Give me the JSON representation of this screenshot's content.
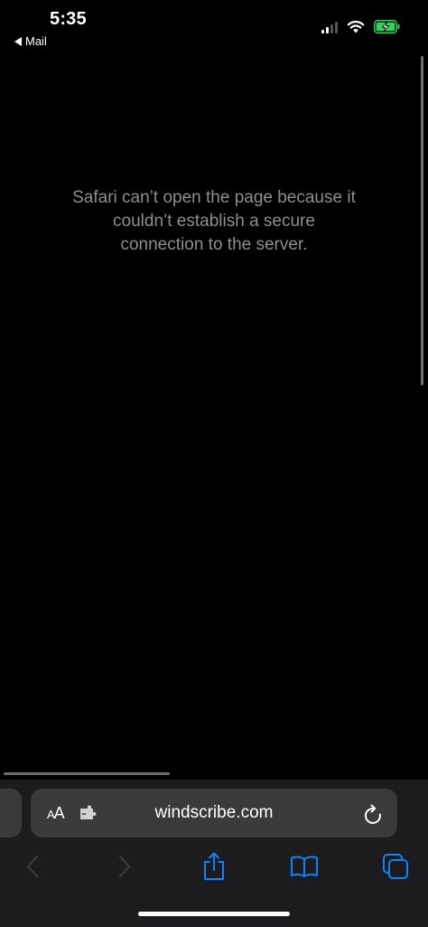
{
  "status_bar": {
    "time": "5:35",
    "back_app": "Mail",
    "signal_bars_filled": 2,
    "signal_bars_total": 4,
    "battery_charging": true,
    "battery_color": "#30d158"
  },
  "page": {
    "message_lines": [
      "Safari can’t open the page because it",
      "couldn’t establish a secure",
      "connection to the server."
    ]
  },
  "address_bar": {
    "reader_label_large": "A",
    "reader_label_small": "A",
    "url": "windscribe.com"
  },
  "toolbar": {
    "back_enabled": false,
    "forward_enabled": false,
    "accent_color": "#0a84ff",
    "disabled_color": "#3a3a3c"
  }
}
